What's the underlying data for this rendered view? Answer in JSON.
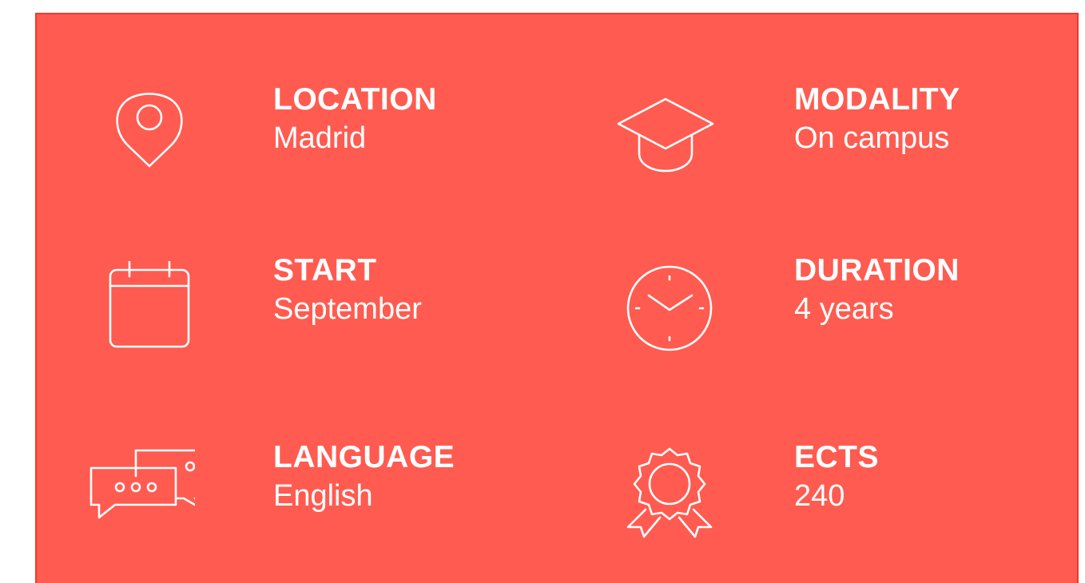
{
  "theme": {
    "panel_color": "#ff5b50",
    "border_color": "#f0392e",
    "text_color": "#ffffff"
  },
  "items": [
    {
      "icon": "location-pin-icon",
      "label": "LOCATION",
      "value": "Madrid"
    },
    {
      "icon": "graduation-cap-icon",
      "label": "MODALITY",
      "value": "On campus"
    },
    {
      "icon": "calendar-icon",
      "label": "START",
      "value": "September"
    },
    {
      "icon": "clock-icon",
      "label": "DURATION",
      "value": "4 years"
    },
    {
      "icon": "chat-bubbles-icon",
      "label": "LANGUAGE",
      "value": "English"
    },
    {
      "icon": "award-badge-icon",
      "label": "ECTS",
      "value": "240"
    }
  ]
}
